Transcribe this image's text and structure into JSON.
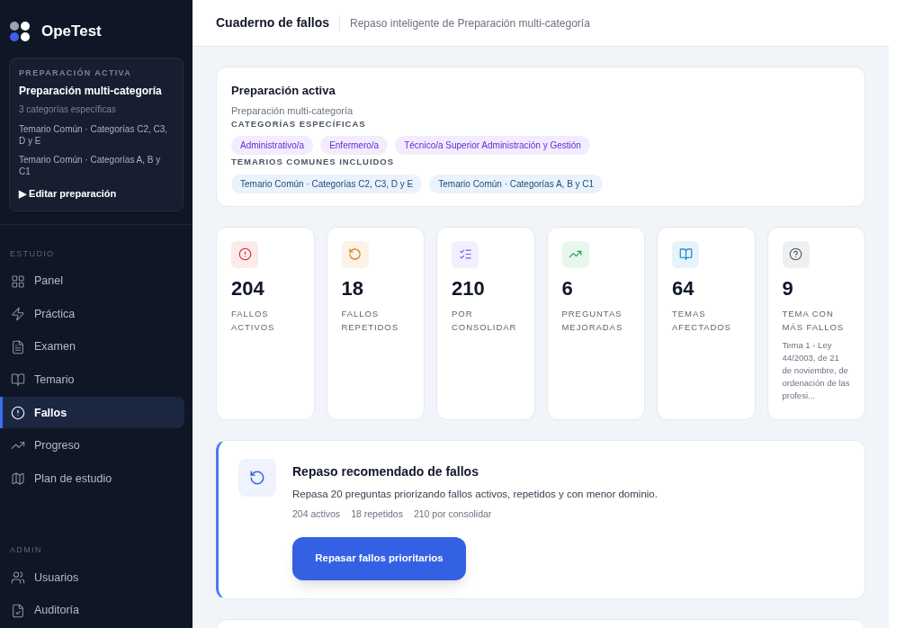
{
  "brand": {
    "name": "OpeTest"
  },
  "active_prep": {
    "label": "PREPARACIÓN ACTIVA",
    "title": "Preparación multi-categoría",
    "subtitle": "3 categorías específicas",
    "temarios": [
      "Temario Común · Categorías C2, C3, D y E",
      "Temario Común · Categorías A, B y C1"
    ],
    "action": "Editar preparación",
    "action_marker": "▶"
  },
  "sidebar": {
    "sections": [
      {
        "title": "ESTUDIO",
        "items": [
          {
            "label": "Panel",
            "selected": false
          },
          {
            "label": "Práctica",
            "selected": false
          },
          {
            "label": "Examen",
            "selected": false
          },
          {
            "label": "Temario",
            "selected": false
          },
          {
            "label": "Fallos",
            "selected": true
          },
          {
            "label": "Progreso",
            "selected": false
          },
          {
            "label": "Plan de estudio",
            "selected": false
          }
        ]
      },
      {
        "title": "ADMIN",
        "items": [
          {
            "label": "Usuarios",
            "selected": false
          },
          {
            "label": "Auditoría",
            "selected": false
          }
        ]
      }
    ]
  },
  "header": {
    "title": "Cuaderno de fallos",
    "subtitle": "Repaso inteligente de Preparación multi-categoría"
  },
  "prep_card": {
    "title": "Preparación activa",
    "subtitle": "Preparación multi-categoría",
    "categories_label": "CATEGORÍAS ESPECÍFICAS",
    "categories": [
      "Administrativo/a",
      "Enfermero/a",
      "Técnico/a Superior Administración y Gestión"
    ],
    "temarios_label": "TEMARIOS COMUNES INCLUIDOS",
    "temarios": [
      "Temario Común · Categorías C2, C3, D y E",
      "Temario Común · Categorías A, B y C1"
    ]
  },
  "stats": [
    {
      "value": "204",
      "label": "FALLOS ACTIVOS",
      "color": "#dc2626"
    },
    {
      "value": "18",
      "label": "FALLOS REPETIDOS",
      "color": "#d97706"
    },
    {
      "value": "210",
      "label": "POR CONSOLIDAR",
      "color": "#6d5dfc"
    },
    {
      "value": "6",
      "label": "PREGUNTAS MEJORADAS",
      "color": "#16a34a"
    },
    {
      "value": "64",
      "label": "TEMAS AFECTADOS",
      "color": "#0284c7"
    },
    {
      "value": "9",
      "label": "TEMA CON MÁS FALLOS",
      "color": "#4b5563",
      "detail": "Tema 1 - Ley 44/2003, de 21 de noviembre, de ordenación de las profesi..."
    }
  ],
  "recommend": {
    "title": "Repaso recomendado de fallos",
    "description": "Repasa 20 preguntas priorizando fallos activos, repetidos y con menor dominio.",
    "meta": [
      "204 activos",
      "18 repetidos",
      "210 por consolidar"
    ],
    "button": "Repasar fallos prioritarios"
  }
}
